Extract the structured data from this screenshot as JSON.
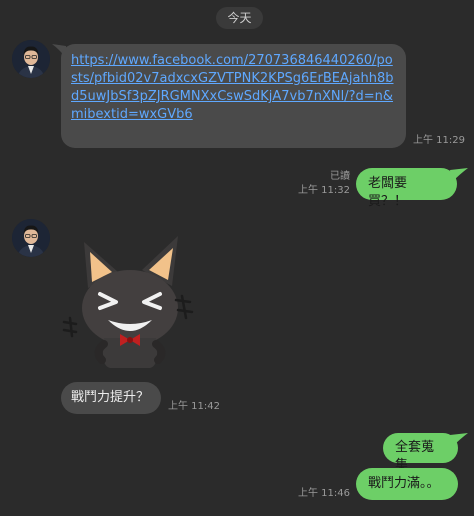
{
  "chat": {
    "date_divider": "今天",
    "messages": [
      {
        "type": "link",
        "sender": "other",
        "text": "https://www.facebook.com/270736846440260/posts/pfbid02v7adxcxGZVTPNK2KPSg6ErBEAjahh8bd5uwJbSf3pZJRGMNXxCswSdKjA7vb7nXNl/?d=n&mibextid=wxGVb6",
        "time": "上午 11:29"
      },
      {
        "type": "text",
        "sender": "me",
        "text": "老闆要買？！",
        "read": "已讀",
        "time": "上午 11:32"
      },
      {
        "type": "sticker",
        "sender": "other",
        "sticker_name": "cat-sticker"
      },
      {
        "type": "text",
        "sender": "other",
        "text": "戰鬥力提升？",
        "time": "上午 11:42"
      },
      {
        "type": "text",
        "sender": "me",
        "text": "全套蒐集"
      },
      {
        "type": "text",
        "sender": "me",
        "text": "戰鬥力滿。。",
        "time": "上午 11:46"
      }
    ]
  },
  "colors": {
    "background": "#2b2b2b",
    "incoming_bubble": "#4a4a4a",
    "outgoing_bubble": "#6dcf67",
    "link": "#5fa8ff"
  }
}
